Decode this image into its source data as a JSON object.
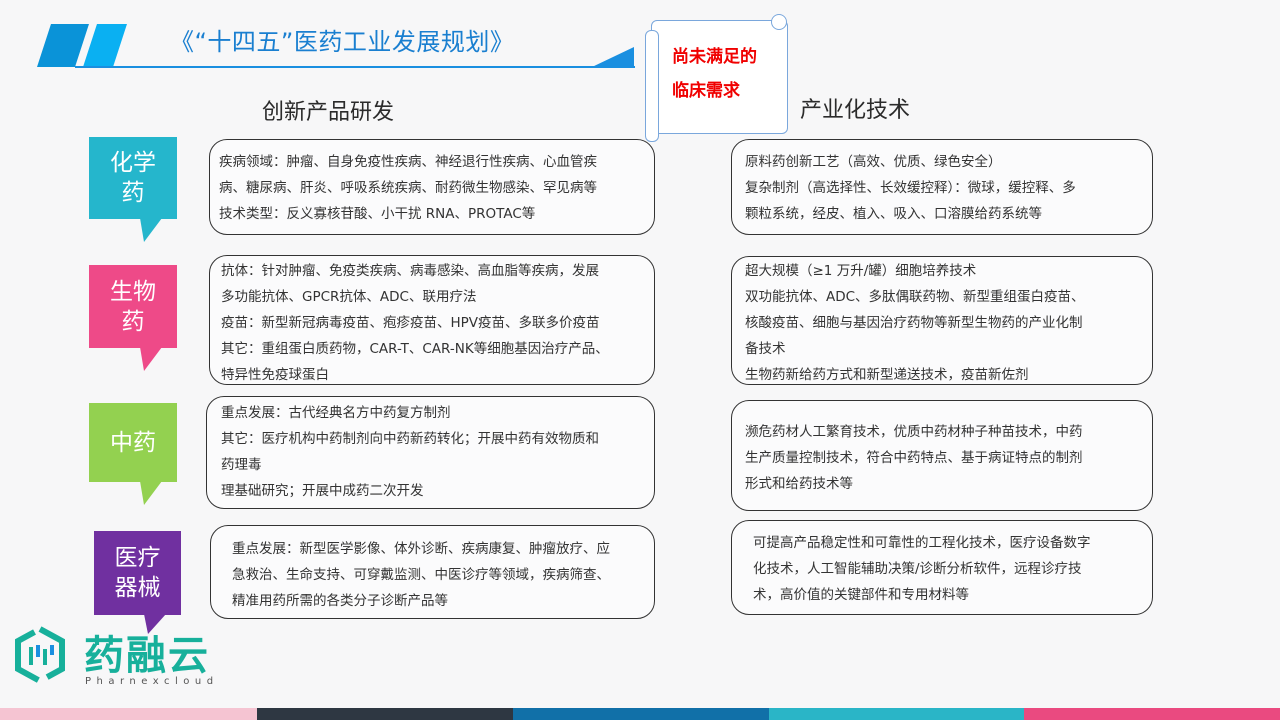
{
  "header": {
    "title": "《“十四五”医药工业发展规划》",
    "callout_line1": "尚未满足的",
    "callout_line2": "临床需求"
  },
  "columns": {
    "left_heading": "创新产品研发",
    "right_heading": "产业化技术"
  },
  "categories": [
    {
      "label_line1": "化学",
      "label_line2": "药",
      "color": "#25b6cc"
    },
    {
      "label_line1": "生物",
      "label_line2": "药",
      "color": "#ee4a88"
    },
    {
      "label_line1": "中药",
      "label_line2": "",
      "color": "#93d150"
    },
    {
      "label_line1": "医疗",
      "label_line2": "器械",
      "color": "#7030a0"
    }
  ],
  "innovation": [
    [
      "疾病领域：肿瘤、自身免疫性疾病、神经退行性疾病、心血管疾",
      "病、糖尿病、肝炎、呼吸系统疾病、耐药微生物感染、罕见病等",
      "技术类型：反义寡核苷酸、小干扰 RNA、PROTAC等"
    ],
    [
      "抗体：针对肿瘤、免疫类疾病、病毒感染、高血脂等疾病，发展",
      "多功能抗体、GPCR抗体、ADC、联用疗法",
      "疫苗：新型新冠病毒疫苗、疱疹疫苗、HPV疫苗、多联多价疫苗",
      "其它：重组蛋白质药物，CAR-T、CAR-NK等细胞基因治疗产品、",
      "特异性免疫球蛋白"
    ],
    [
      "重点发展：古代经典名方中药复方制剂",
      "其它：医疗机构中药制剂向中药新药转化；开展中药有效物质和",
      "药理毒",
      "理基础研究；开展中成药二次开发"
    ],
    [
      "重点发展：新型医学影像、体外诊断、疾病康复、肿瘤放疗、应",
      "急救治、生命支持、可穿戴监测、中医诊疗等领域，疾病筛查、",
      "精准用药所需的各类分子诊断产品等"
    ]
  ],
  "industrialization": [
    [
      "原料药创新工艺（高效、优质、绿色安全）",
      "复杂制剂（高选择性、长效缓控释）：微球，缓控释、多",
      "颗粒系统，经皮、植入、吸入、口溶膜给药系统等"
    ],
    [
      "超大规模（≥1 万升/罐）细胞培养技术",
      "双功能抗体、ADC、多肽偶联药物、新型重组蛋白疫苗、",
      "核酸疫苗、细胞与基因治疗药物等新型生物药的产业化制",
      "备技术",
      "生物药新给药方式和新型递送技术，疫苗新佐剂"
    ],
    [
      "濒危药材人工繁育技术，优质中药材种子种苗技术，中药",
      "生产质量控制技术，符合中药特点、基于病证特点的制剂",
      "形式和给药技术等"
    ],
    [
      "可提高产品稳定性和可靠性的工程化技术，医疗设备数字",
      "化技术，人工智能辅助决策/诊断分析软件，远程诊疗技",
      "术，高价值的关键部件和专用材料等"
    ]
  ],
  "logo": {
    "name": "药融云",
    "subtitle": "Pharnexcloud",
    "color": "#17b09b"
  },
  "footer_colors": [
    "#f5c4d2",
    "#2e3742",
    "#1170a8",
    "#2ab5c7",
    "#ea4a80"
  ]
}
